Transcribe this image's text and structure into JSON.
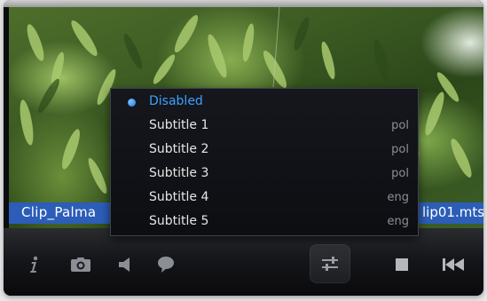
{
  "filename": {
    "left_text": "Clip_Palma",
    "right_text": "lip01.mts"
  },
  "subtitle_menu": {
    "items": [
      {
        "label": "Disabled",
        "lang": "",
        "selected": true
      },
      {
        "label": "Subtitle 1",
        "lang": "pol",
        "selected": false
      },
      {
        "label": "Subtitle 2",
        "lang": "pol",
        "selected": false
      },
      {
        "label": "Subtitle 3",
        "lang": "pol",
        "selected": false
      },
      {
        "label": "Subtitle 4",
        "lang": "eng",
        "selected": false
      },
      {
        "label": "Subtitle 5",
        "lang": "eng",
        "selected": false
      }
    ]
  },
  "controls": {
    "info_icon": "info-icon",
    "snapshot_icon": "camera-icon",
    "volume_icon": "speaker-icon",
    "subtitles_icon": "speech-bubble-icon",
    "settings_icon": "equalizer-sliders-icon",
    "stop_icon": "stop-icon",
    "previous_icon": "skip-back-icon"
  },
  "colors": {
    "accent": "#3ea0ff",
    "filename_highlight": "#2c5db8",
    "menu_background": "#111318"
  }
}
